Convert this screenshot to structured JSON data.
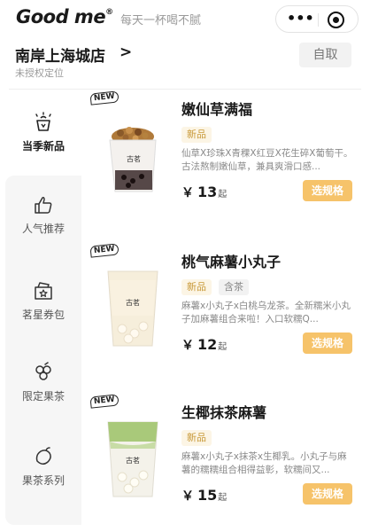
{
  "header": {
    "brand": "Good me",
    "brand_mark": "®",
    "slogan": "每天一杯喝不腻",
    "more_icon_text": "•••"
  },
  "store": {
    "name": "南岸上海城店",
    "arrow": ">",
    "location_status": "未授权定位",
    "pickup_label": "自取"
  },
  "sidebar": {
    "items": [
      {
        "label": "当季新品",
        "icon": "sparkle-cup-icon",
        "active": true
      },
      {
        "label": "人气推荐",
        "icon": "thumbs-up-icon",
        "active": false
      },
      {
        "label": "茗星券包",
        "icon": "coupon-pack-icon",
        "active": false
      },
      {
        "label": "限定果茶",
        "icon": "grapes-icon",
        "active": false
      },
      {
        "label": "果茶系列",
        "icon": "mango-icon",
        "active": false
      }
    ]
  },
  "products": [
    {
      "badge": "NEW",
      "name": "嫩仙草满福",
      "tags": [
        "新品"
      ],
      "description": "仙草X珍珠X青稞X红豆X花生碎X葡萄干。古法熬制嫩仙草，兼具爽滑口感...",
      "currency": "￥",
      "price": "13",
      "price_suffix": "起",
      "action": "选规格",
      "cup_label": "古茗"
    },
    {
      "badge": "NEW",
      "name": "桃气麻薯小丸子",
      "tags": [
        "新品",
        "含茶"
      ],
      "description": "麻薯x小丸子x白桃乌龙茶。全新糯米小丸子加麻薯组合来啦！入口软糯Q...",
      "currency": "￥",
      "price": "12",
      "price_suffix": "起",
      "action": "选规格",
      "cup_label": "古茗"
    },
    {
      "badge": "NEW",
      "name": "生椰抹茶麻薯",
      "tags": [
        "新品"
      ],
      "description": "麻薯x小丸子x抹茶x生椰乳。小丸子与麻薯的糯糯组合相得益彰，软糯间又...",
      "currency": "￥",
      "price": "15",
      "price_suffix": "起",
      "action": "选规格",
      "cup_label": "古茗"
    }
  ],
  "colors": {
    "accent": "#f6c36a",
    "tag_text": "#c99a3a",
    "tag_bg": "#fcf5e5",
    "sidebar_bg": "#f6f6f6"
  }
}
